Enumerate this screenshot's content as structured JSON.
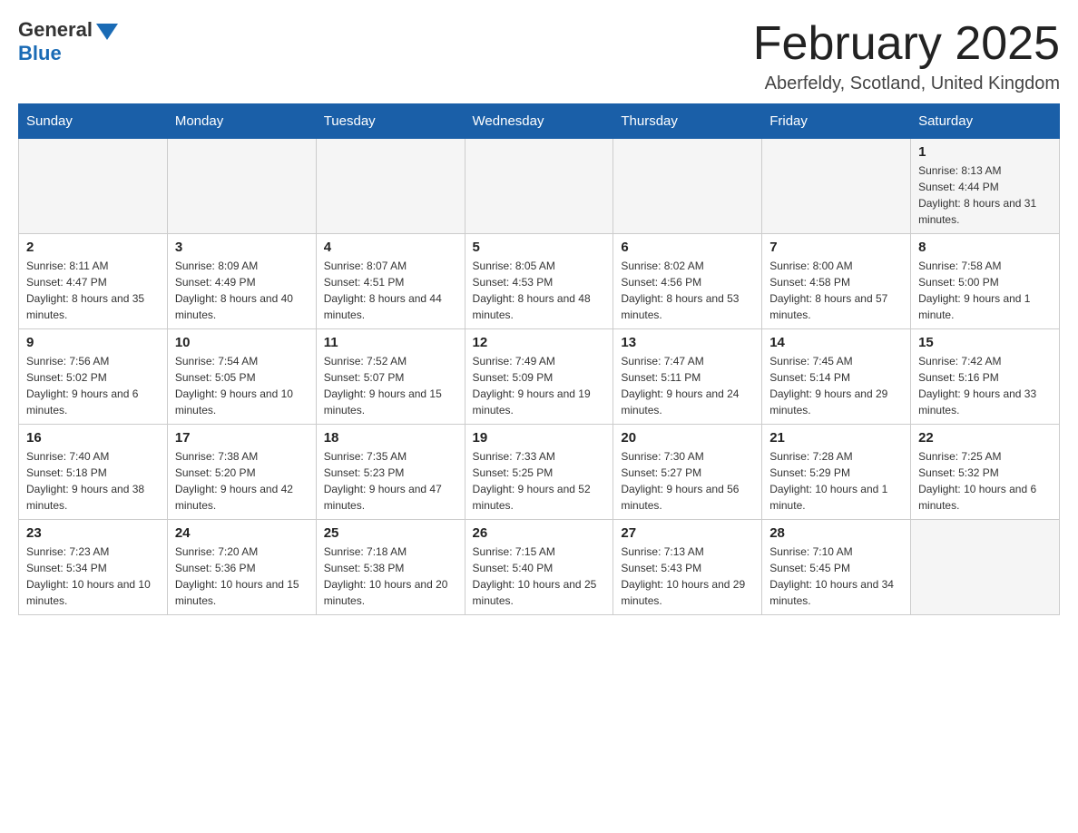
{
  "header": {
    "logo_general": "General",
    "logo_blue": "Blue",
    "month_title": "February 2025",
    "location": "Aberfeldy, Scotland, United Kingdom"
  },
  "days_of_week": [
    "Sunday",
    "Monday",
    "Tuesday",
    "Wednesday",
    "Thursday",
    "Friday",
    "Saturday"
  ],
  "weeks": [
    [
      {
        "day": "",
        "info": ""
      },
      {
        "day": "",
        "info": ""
      },
      {
        "day": "",
        "info": ""
      },
      {
        "day": "",
        "info": ""
      },
      {
        "day": "",
        "info": ""
      },
      {
        "day": "",
        "info": ""
      },
      {
        "day": "1",
        "info": "Sunrise: 8:13 AM\nSunset: 4:44 PM\nDaylight: 8 hours and 31 minutes."
      }
    ],
    [
      {
        "day": "2",
        "info": "Sunrise: 8:11 AM\nSunset: 4:47 PM\nDaylight: 8 hours and 35 minutes."
      },
      {
        "day": "3",
        "info": "Sunrise: 8:09 AM\nSunset: 4:49 PM\nDaylight: 8 hours and 40 minutes."
      },
      {
        "day": "4",
        "info": "Sunrise: 8:07 AM\nSunset: 4:51 PM\nDaylight: 8 hours and 44 minutes."
      },
      {
        "day": "5",
        "info": "Sunrise: 8:05 AM\nSunset: 4:53 PM\nDaylight: 8 hours and 48 minutes."
      },
      {
        "day": "6",
        "info": "Sunrise: 8:02 AM\nSunset: 4:56 PM\nDaylight: 8 hours and 53 minutes."
      },
      {
        "day": "7",
        "info": "Sunrise: 8:00 AM\nSunset: 4:58 PM\nDaylight: 8 hours and 57 minutes."
      },
      {
        "day": "8",
        "info": "Sunrise: 7:58 AM\nSunset: 5:00 PM\nDaylight: 9 hours and 1 minute."
      }
    ],
    [
      {
        "day": "9",
        "info": "Sunrise: 7:56 AM\nSunset: 5:02 PM\nDaylight: 9 hours and 6 minutes."
      },
      {
        "day": "10",
        "info": "Sunrise: 7:54 AM\nSunset: 5:05 PM\nDaylight: 9 hours and 10 minutes."
      },
      {
        "day": "11",
        "info": "Sunrise: 7:52 AM\nSunset: 5:07 PM\nDaylight: 9 hours and 15 minutes."
      },
      {
        "day": "12",
        "info": "Sunrise: 7:49 AM\nSunset: 5:09 PM\nDaylight: 9 hours and 19 minutes."
      },
      {
        "day": "13",
        "info": "Sunrise: 7:47 AM\nSunset: 5:11 PM\nDaylight: 9 hours and 24 minutes."
      },
      {
        "day": "14",
        "info": "Sunrise: 7:45 AM\nSunset: 5:14 PM\nDaylight: 9 hours and 29 minutes."
      },
      {
        "day": "15",
        "info": "Sunrise: 7:42 AM\nSunset: 5:16 PM\nDaylight: 9 hours and 33 minutes."
      }
    ],
    [
      {
        "day": "16",
        "info": "Sunrise: 7:40 AM\nSunset: 5:18 PM\nDaylight: 9 hours and 38 minutes."
      },
      {
        "day": "17",
        "info": "Sunrise: 7:38 AM\nSunset: 5:20 PM\nDaylight: 9 hours and 42 minutes."
      },
      {
        "day": "18",
        "info": "Sunrise: 7:35 AM\nSunset: 5:23 PM\nDaylight: 9 hours and 47 minutes."
      },
      {
        "day": "19",
        "info": "Sunrise: 7:33 AM\nSunset: 5:25 PM\nDaylight: 9 hours and 52 minutes."
      },
      {
        "day": "20",
        "info": "Sunrise: 7:30 AM\nSunset: 5:27 PM\nDaylight: 9 hours and 56 minutes."
      },
      {
        "day": "21",
        "info": "Sunrise: 7:28 AM\nSunset: 5:29 PM\nDaylight: 10 hours and 1 minute."
      },
      {
        "day": "22",
        "info": "Sunrise: 7:25 AM\nSunset: 5:32 PM\nDaylight: 10 hours and 6 minutes."
      }
    ],
    [
      {
        "day": "23",
        "info": "Sunrise: 7:23 AM\nSunset: 5:34 PM\nDaylight: 10 hours and 10 minutes."
      },
      {
        "day": "24",
        "info": "Sunrise: 7:20 AM\nSunset: 5:36 PM\nDaylight: 10 hours and 15 minutes."
      },
      {
        "day": "25",
        "info": "Sunrise: 7:18 AM\nSunset: 5:38 PM\nDaylight: 10 hours and 20 minutes."
      },
      {
        "day": "26",
        "info": "Sunrise: 7:15 AM\nSunset: 5:40 PM\nDaylight: 10 hours and 25 minutes."
      },
      {
        "day": "27",
        "info": "Sunrise: 7:13 AM\nSunset: 5:43 PM\nDaylight: 10 hours and 29 minutes."
      },
      {
        "day": "28",
        "info": "Sunrise: 7:10 AM\nSunset: 5:45 PM\nDaylight: 10 hours and 34 minutes."
      },
      {
        "day": "",
        "info": ""
      }
    ]
  ]
}
